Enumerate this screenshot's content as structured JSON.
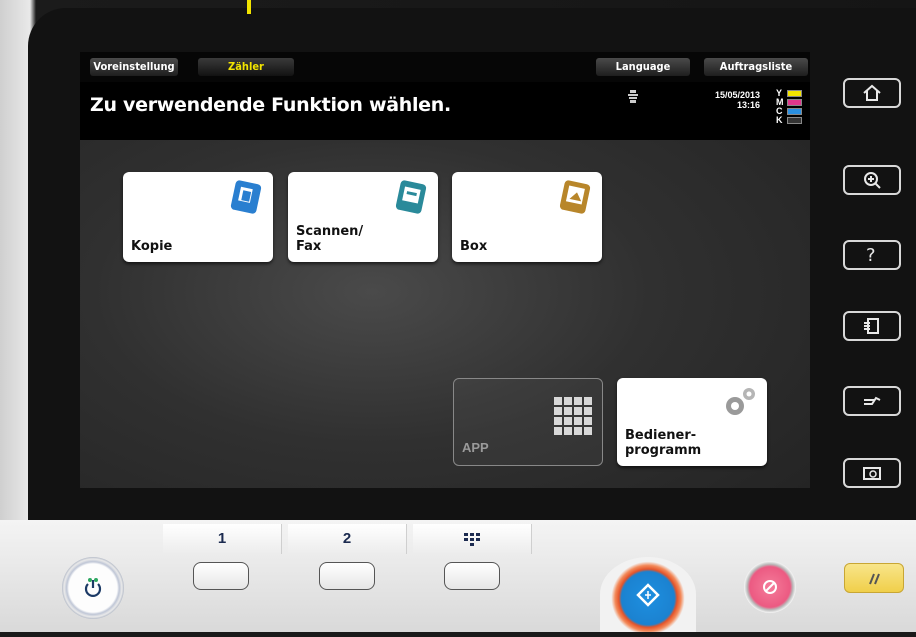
{
  "topbar": {
    "tabs": [
      {
        "label": "Voreinstellung",
        "active": false
      },
      {
        "label": "Zähler",
        "active": true
      },
      {
        "label": "Language",
        "active": false
      },
      {
        "label": "Auftragsliste",
        "active": false
      }
    ]
  },
  "header": {
    "title": "Zu verwendende Funktion wählen.",
    "date": "15/05/2013",
    "time": "13:16",
    "toner": [
      {
        "label": "Y",
        "color": "#f2e400"
      },
      {
        "label": "M",
        "color": "#e0388c"
      },
      {
        "label": "C",
        "color": "#2a8fe0"
      },
      {
        "label": "K",
        "color": "#333333"
      }
    ]
  },
  "functions": {
    "kopie": "Kopie",
    "scannen_fax": "Scannen/\nFax",
    "box": "Box",
    "app": "APP",
    "bedienerprogramm": "Bediener-\nprogramm"
  },
  "side_buttons": [
    "home-icon",
    "zoom-icon",
    "help-icon",
    "job-icon",
    "access-icon",
    "guide-icon"
  ],
  "keypad": {
    "key1": "1",
    "key2": "2",
    "key3_icon": "keypad-icon"
  },
  "colors": {
    "accent_yellow": "#f2e400",
    "start_blue": "#1b82d0",
    "stop_pink": "#ec5a82",
    "reset_yellow": "#f0cf4a"
  }
}
